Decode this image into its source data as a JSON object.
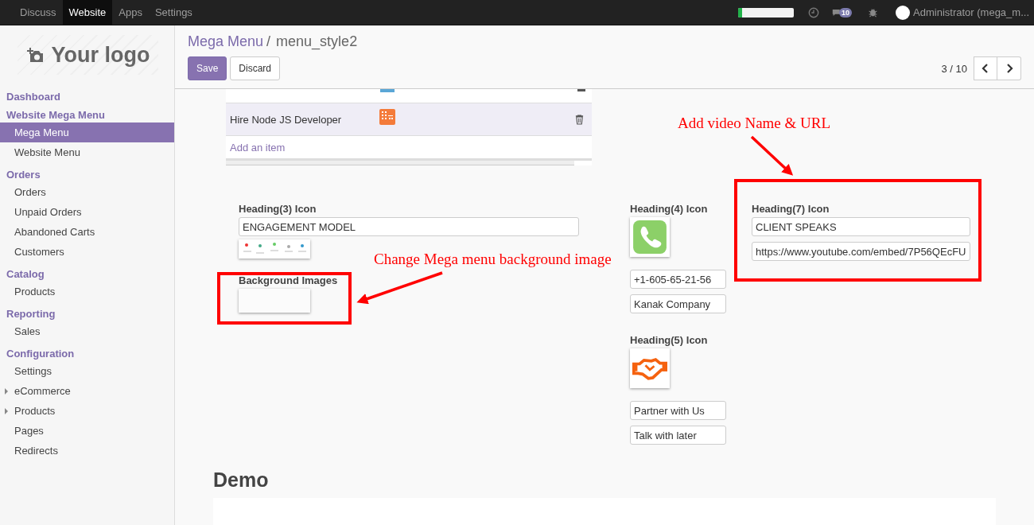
{
  "top_menu": [
    {
      "label": "Discuss",
      "selected": false
    },
    {
      "label": "Website",
      "selected": true
    },
    {
      "label": "Apps",
      "selected": false
    },
    {
      "label": "Settings",
      "selected": false
    }
  ],
  "systray": {
    "level": 0.07,
    "chat_count": "10",
    "user": "Administrator (mega_m..."
  },
  "logo": {
    "text": "Your logo"
  },
  "sidebar": [
    {
      "title": "Dashboard"
    },
    {
      "title": "Website Mega Menu",
      "items": [
        {
          "label": "Mega Menu",
          "selected": true,
          "kind": "link"
        },
        {
          "label": "Website Menu",
          "selected": false,
          "kind": "link"
        }
      ]
    },
    {
      "title": "Orders",
      "items": [
        {
          "label": "Orders",
          "selected": false,
          "kind": "link"
        },
        {
          "label": "Unpaid Orders",
          "selected": false,
          "kind": "link"
        },
        {
          "label": "Abandoned Carts",
          "selected": false,
          "kind": "link"
        },
        {
          "label": "Customers",
          "selected": false,
          "kind": "link"
        }
      ]
    },
    {
      "title": "Catalog",
      "items": [
        {
          "label": "Products",
          "selected": false,
          "kind": "link"
        }
      ]
    },
    {
      "title": "Reporting",
      "items": [
        {
          "label": "Sales",
          "selected": false,
          "kind": "link"
        }
      ]
    },
    {
      "title": "Configuration",
      "items": [
        {
          "label": "Settings",
          "selected": false,
          "kind": "link"
        },
        {
          "label": "eCommerce",
          "selected": false,
          "kind": "group",
          "expanded": false
        },
        {
          "label": "Products",
          "selected": false,
          "kind": "group",
          "expanded": false
        },
        {
          "label": "Pages",
          "selected": false,
          "kind": "link"
        },
        {
          "label": "Redirects",
          "selected": false,
          "kind": "link"
        }
      ]
    }
  ],
  "breadcrumb": {
    "parent": "Mega Menu",
    "separator": "/",
    "current": "menu_style2"
  },
  "buttons": [
    {
      "label": "Save",
      "kind": "primary"
    },
    {
      "label": "Discard",
      "kind": "secondary"
    }
  ],
  "pager": {
    "value": "3 / 10"
  },
  "lines": {
    "rows": [
      {
        "name": "Hire Node JS Developer",
        "selected": true
      }
    ],
    "add_link": "Add an item"
  },
  "heading3": {
    "label": "Heading(3) Icon",
    "value": "ENGAGEMENT MODEL",
    "background_label": "Background Images"
  },
  "heading4": {
    "label": "Heading(4) Icon",
    "values": [
      "+1-605-65-21-56",
      "Kanak Company"
    ]
  },
  "heading5": {
    "label": "Heading(5) Icon",
    "values": [
      "Partner with Us",
      "Talk with later"
    ]
  },
  "heading7": {
    "label": "Heading(7) Icon",
    "values": [
      "CLIENT SPEAKS",
      "https://www.youtube.com/embed/7P56QEcFU"
    ]
  },
  "annotations": [
    {
      "text": "Add video Name & URL"
    },
    {
      "text": "Change Mega menu background image"
    }
  ],
  "demo": {
    "title": "Demo"
  }
}
